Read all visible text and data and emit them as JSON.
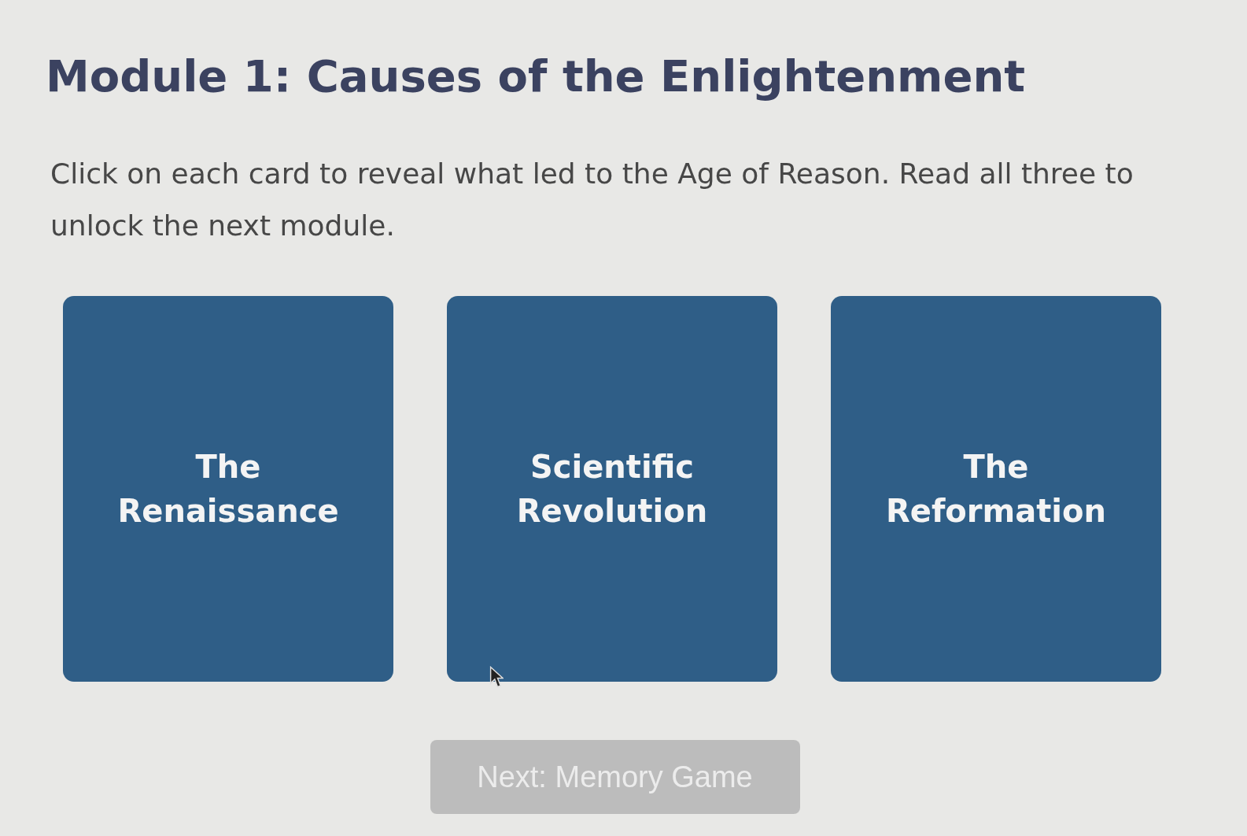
{
  "title": "Module 1: Causes of the Enlightenment",
  "instructions": "Click on each card to reveal what led to the Age of Reason. Read all three to unlock the next module.",
  "cards": [
    {
      "title": "The Renaissance"
    },
    {
      "title": "Scientific Revolution"
    },
    {
      "title": "The Reformation"
    }
  ],
  "next_button": {
    "label": "Next: Memory Game",
    "disabled": true
  }
}
